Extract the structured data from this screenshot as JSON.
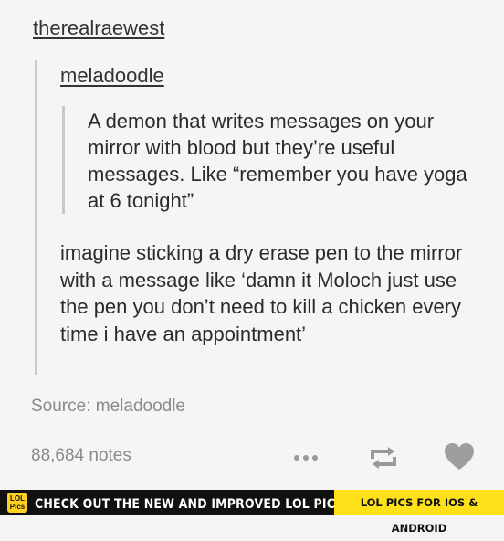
{
  "post": {
    "original_user": "therealraewest",
    "reblogged_user": "meladoodle",
    "quote": "A demon that writes messages on your mirror with blood but they’re useful messages. Like “remember you have yoga at 6 tonight”",
    "reply": "imagine sticking a dry erase pen to the mirror with a message like ‘damn it Moloch just use the pen you don’t need to kill a chicken every time i have an appointment’",
    "source": "Source: meladoodle",
    "notes": "88,684 notes"
  },
  "icons": {
    "more": "more-dots-icon",
    "reblog": "reblog-icon",
    "like": "heart-icon"
  },
  "banner": {
    "logo_top": "LOL",
    "logo_bottom": "Pics",
    "text": "CHECK OUT THE NEW AND IMPROVED LOL PICS!",
    "cta": "LOL PICS FOR IOS & ANDROID"
  },
  "colors": {
    "background": "#f5f5f5",
    "text": "#2b2b2b",
    "muted": "#8a8a8a",
    "banner_bg": "#111111",
    "banner_accent": "#ffe11a"
  }
}
